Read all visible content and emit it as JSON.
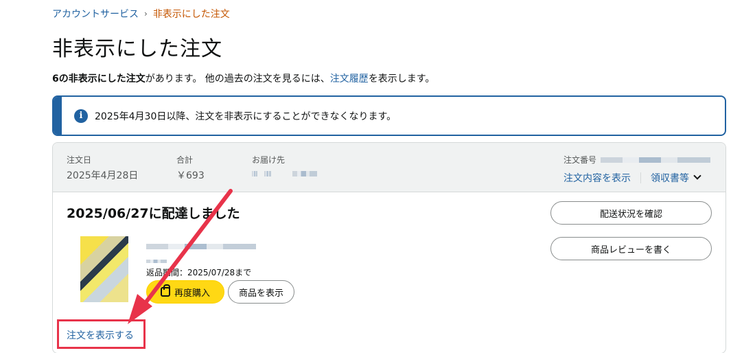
{
  "breadcrumb": {
    "parent": "アカウントサービス",
    "separator": "›",
    "current": "非表示にした注文"
  },
  "page_title": "非表示にした注文",
  "summary": {
    "count_bold": "6の非表示にした注文",
    "text_mid": "があります。 他の過去の注文を見るには、",
    "history_link": "注文履歴",
    "text_end": "を表示します。"
  },
  "alert": {
    "icon": "info-icon",
    "text": "2025年4月30日以降、注文を非表示にすることができなくなります。"
  },
  "order": {
    "date_label": "注文日",
    "date_value": "2025年4月28日",
    "total_label": "合計",
    "total_value": "￥693",
    "ship_to_label": "お届け先",
    "order_number_label": "注文番号",
    "view_details_link": "注文内容を表示",
    "receipt_link": "領収書等",
    "delivery_status": "2025/06/27に配達しました",
    "return_info": "返品期間：2025/07/28まで",
    "buy_again_label": "再度購入",
    "view_item_label": "商品を表示",
    "track_button": "配送状況を確認",
    "review_button": "商品レビューを書く",
    "show_order_link": "注文を表示する"
  },
  "colors": {
    "link": "#2162a1",
    "breadcrumb_current": "#c45500",
    "alert_border": "#2162a1",
    "buy_button": "#ffd814",
    "annotation_red": "#e8334a"
  }
}
